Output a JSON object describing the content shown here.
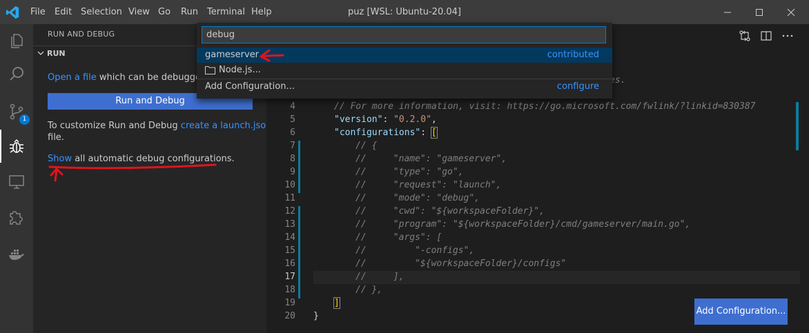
{
  "titlebar": {
    "title": "puz [WSL: Ubuntu-20.04]",
    "menu": [
      "File",
      "Edit",
      "Selection",
      "View",
      "Go",
      "Run",
      "Terminal",
      "Help"
    ]
  },
  "activity": {
    "icons": [
      "explorer-icon",
      "search-icon",
      "source-control-icon",
      "run-debug-icon",
      "remote-explorer-icon",
      "extensions-icon",
      "docker-icon"
    ],
    "source_control_badge": "1"
  },
  "sidebar": {
    "title": "RUN AND DEBUG",
    "section": "RUN",
    "open_file_link": "Open a file",
    "open_file_text": " which can be debugged o",
    "run_button": "Run and Debug",
    "customize_text": "To customize Run and Debug ",
    "create_link": "create a launch.json",
    "file_text": "file.",
    "show_link": "Show",
    "show_text": " all automatic debug configurations."
  },
  "quickpick": {
    "value": "debug",
    "items": [
      {
        "label": "gameserver",
        "description": "contributed"
      },
      {
        "label": "Node.js...",
        "description": ""
      },
      {
        "label": "Add Configuration...",
        "description": "configure"
      }
    ]
  },
  "editor": {
    "partial_line": "es.",
    "line_numbers": [
      "4",
      "5",
      "6",
      "7",
      "8",
      "9",
      "10",
      "11",
      "12",
      "13",
      "14",
      "15",
      "16",
      "17",
      "18",
      "19",
      "20"
    ],
    "current_line": "17",
    "lines": {
      "l4": "// For more information, visit: https://go.microsoft.com/fwlink/?linkid=830387",
      "l5_key": "\"version\"",
      "l5_val": "\"0.2.0\"",
      "l6_key": "\"configurations\"",
      "l7": "// {",
      "l8": "//     \"name\": \"gameserver\",",
      "l9": "//     \"type\": \"go\",",
      "l10": "//     \"request\": \"launch\",",
      "l11": "//     \"mode\": \"debug\",",
      "l12": "//     \"cwd\": \"${workspaceFolder}\",",
      "l13": "//     \"program\": \"${workspaceFolder}/cmd/gameserver/main.go\",",
      "l14": "//     \"args\": [",
      "l15": "//         \"-configs\",",
      "l16": "//         \"${workspaceFolder}/configs\"",
      "l17": "//     ],",
      "l18": "// },",
      "l19": "]",
      "l20": "}"
    },
    "add_configuration_button": "Add Configuration..."
  },
  "colors": {
    "accent": "#3e6fd0",
    "link": "#3794ff",
    "annotation": "#e0141e"
  }
}
